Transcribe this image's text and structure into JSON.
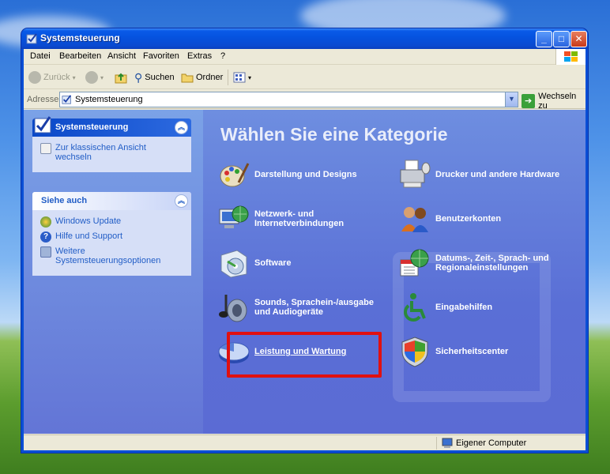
{
  "window": {
    "title": "Systemsteuerung"
  },
  "menubar": {
    "items": [
      "Datei",
      "Bearbeiten",
      "Ansicht",
      "Favoriten",
      "Extras",
      "?"
    ]
  },
  "toolbar": {
    "back_label": "Zurück",
    "search_label": "Suchen",
    "folders_label": "Ordner"
  },
  "address": {
    "label": "Adresse",
    "value": "Systemsteuerung",
    "go_label": "Wechseln zu"
  },
  "sidebar": {
    "panel1": {
      "title": "Systemsteuerung",
      "link": "Zur klassischen Ansicht wechseln"
    },
    "panel2": {
      "title": "Siehe auch",
      "links": [
        "Windows Update",
        "Hilfe und Support",
        "Weitere Systemsteuerungsoptionen"
      ]
    }
  },
  "main": {
    "heading": "Wählen Sie eine Kategorie",
    "categories": [
      {
        "label": "Darstellung und Designs",
        "icon": "appearance-icon"
      },
      {
        "label": "Drucker und andere Hardware",
        "icon": "printer-icon"
      },
      {
        "label": "Netzwerk- und Internetverbindungen",
        "icon": "network-icon"
      },
      {
        "label": "Benutzerkonten",
        "icon": "users-icon"
      },
      {
        "label": "Software",
        "icon": "software-icon"
      },
      {
        "label": "Datums-, Zeit-, Sprach- und Regionaleinstellungen",
        "icon": "datetime-icon"
      },
      {
        "label": "Sounds, Sprachein-/ausgabe und Audiogeräte",
        "icon": "sound-icon"
      },
      {
        "label": "Eingabehilfen",
        "icon": "accessibility-icon"
      },
      {
        "label": "Leistung und Wartung",
        "icon": "performance-icon"
      },
      {
        "label": "Sicherheitscenter",
        "icon": "shield-icon"
      }
    ]
  },
  "statusbar": {
    "location": "Eigener Computer"
  }
}
